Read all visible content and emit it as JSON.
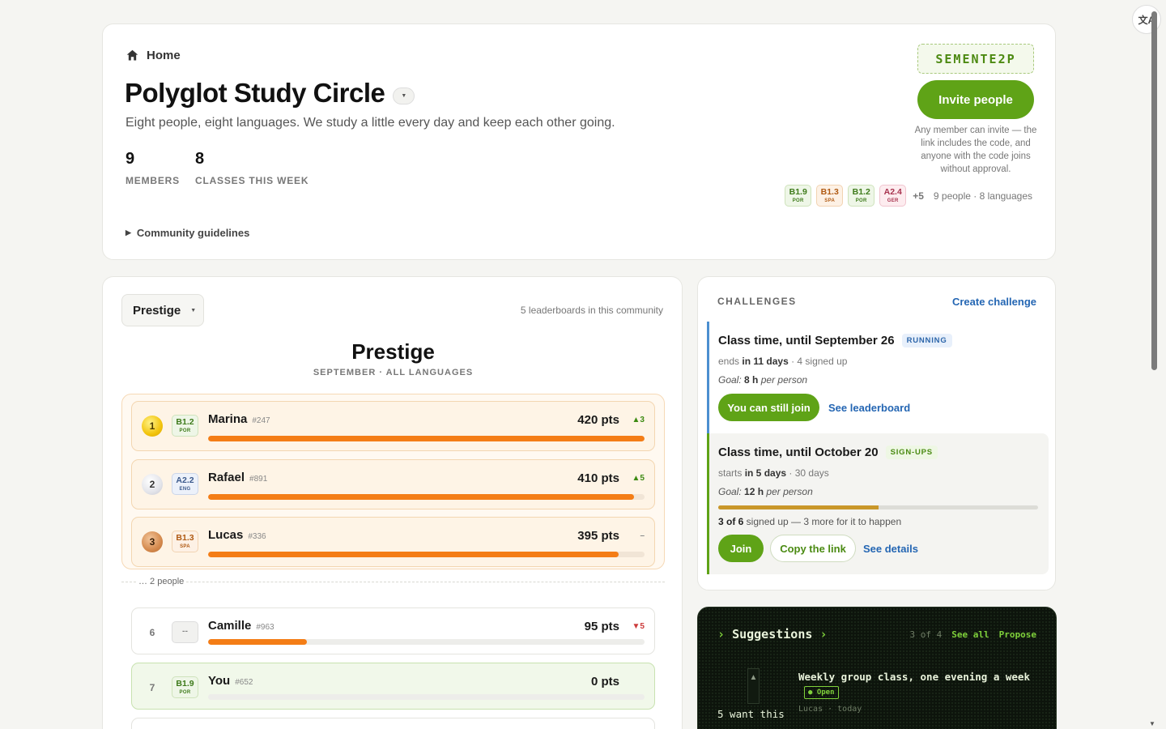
{
  "header": {
    "home_label": "Home",
    "title": "Polyglot Study Circle",
    "description": "Eight people, eight languages. We study a little every day and keep each other going.",
    "stats": [
      {
        "value": "9",
        "label": "MEMBERS"
      },
      {
        "value": "8",
        "label": "CLASSES THIS WEEK"
      }
    ],
    "guidelines_label": "Community guidelines",
    "invite_code": "SEMENTE2P",
    "invite_button": "Invite people",
    "invite_note": "Any member can invite — the link includes the code, and anyone with the code joins without approval.",
    "levels": [
      {
        "level": "B1.9",
        "lang": "POR",
        "kind": "por"
      },
      {
        "level": "B1.3",
        "lang": "SPA",
        "kind": "spa"
      },
      {
        "level": "B1.2",
        "lang": "POR",
        "kind": "por"
      },
      {
        "level": "A2.4",
        "lang": "GER",
        "kind": "ger"
      }
    ],
    "levels_more": "+5",
    "people_languages": "9 people · 8 languages"
  },
  "leaderboard": {
    "selected": "Prestige",
    "count_text": "5 leaderboards in this community",
    "title": "Prestige",
    "subtitle": "SEPTEMBER · ALL LANGUAGES",
    "gap_text": "… 2 people",
    "rows": [
      {
        "rank": "1",
        "medal": "gold",
        "level": "B1.2",
        "lang": "POR",
        "kind": "por",
        "name": "Marina",
        "tag": "#247",
        "pts": "420 pts",
        "delta": "▲3",
        "dir": "up",
        "progress": 1.0
      },
      {
        "rank": "2",
        "medal": "silver",
        "level": "A2.2",
        "lang": "ENG",
        "kind": "eng",
        "name": "Rafael",
        "tag": "#891",
        "pts": "410 pts",
        "delta": "▲5",
        "dir": "up",
        "progress": 0.976
      },
      {
        "rank": "3",
        "medal": "bronze",
        "level": "B1.3",
        "lang": "SPA",
        "kind": "spa",
        "name": "Lucas",
        "tag": "#336",
        "pts": "395 pts",
        "delta": "–",
        "dir": "flat",
        "progress": 0.94
      },
      {
        "rank": "6",
        "medal": "flat",
        "level": "--",
        "lang": "",
        "kind": "none",
        "name": "Camille",
        "tag": "#963",
        "pts": "95 pts",
        "delta": "▼5",
        "dir": "down",
        "progress": 0.226
      },
      {
        "rank": "7",
        "medal": "flat",
        "level": "B1.9",
        "lang": "POR",
        "kind": "por",
        "name": "You",
        "tag": "#652",
        "pts": "0 pts",
        "delta": "",
        "dir": "flat",
        "progress": 0.0
      }
    ]
  },
  "challenges": {
    "heading": "CHALLENGES",
    "create_label": "Create challenge",
    "items": [
      {
        "title": "Class time, until September 26",
        "badge": "RUNNING",
        "meta_prefix": "ends",
        "meta_bold": "in 11 days",
        "meta_rest": " · 4 signed up",
        "goal_prefix": "Goal:",
        "goal_value": "8 h",
        "goal_suffix": "per person",
        "primary": "You can still join",
        "link": "See leaderboard"
      },
      {
        "title": "Class time, until October 20",
        "badge": "SIGN-UPS",
        "meta_prefix": "starts",
        "meta_bold": "in 5 days",
        "meta_rest": " · 30 days",
        "goal_prefix": "Goal:",
        "goal_value": "12 h",
        "goal_suffix": "per person",
        "progress": 0.5,
        "signed_bold": "3 of 6",
        "signed_rest": " signed up — 3 more for it to happen",
        "primary": "Join",
        "secondary": "Copy the link",
        "link": "See details"
      }
    ]
  },
  "suggestions": {
    "title": "Suggestions",
    "count": "3 of 4",
    "see_all": "See all",
    "propose": "Propose",
    "item": {
      "text": "Weekly group class, one evening a week",
      "status": "Open",
      "by": "Lucas · today",
      "want": "5 want this"
    }
  },
  "chrome": {
    "translate_icon": "translate-icon"
  }
}
